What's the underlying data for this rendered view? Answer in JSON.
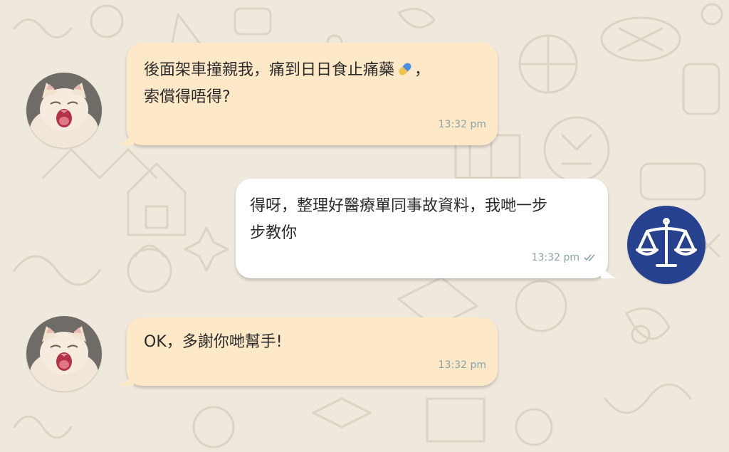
{
  "colors": {
    "wallpaper": "#efe8dc",
    "incoming_bubble": "#fde8c7",
    "outgoing_bubble": "#ffffff",
    "timestamp": "#8aa3a6",
    "read_ticks": "#8aa3a6",
    "lawyer_avatar_bg": "#26428f"
  },
  "messages": [
    {
      "direction": "incoming",
      "avatar": "cat-avatar",
      "line1_before_emoji": "後面架車撞親我，痛到日日食止痛藥",
      "emoji": "pill-icon",
      "line1_after_emoji": "，",
      "line2": "索償得唔得?",
      "time": "13:32 pm"
    },
    {
      "direction": "outgoing",
      "avatar": "scales-of-justice-icon",
      "line1": "得呀，整理好醫療單同事故資料，我哋一步",
      "line2": "步教你",
      "time": "13:32 pm",
      "status_icon": "double-check-icon"
    },
    {
      "direction": "incoming",
      "avatar": "cat-avatar",
      "line1": "OK，多謝你哋幫手!",
      "time": "13:32 pm"
    }
  ]
}
